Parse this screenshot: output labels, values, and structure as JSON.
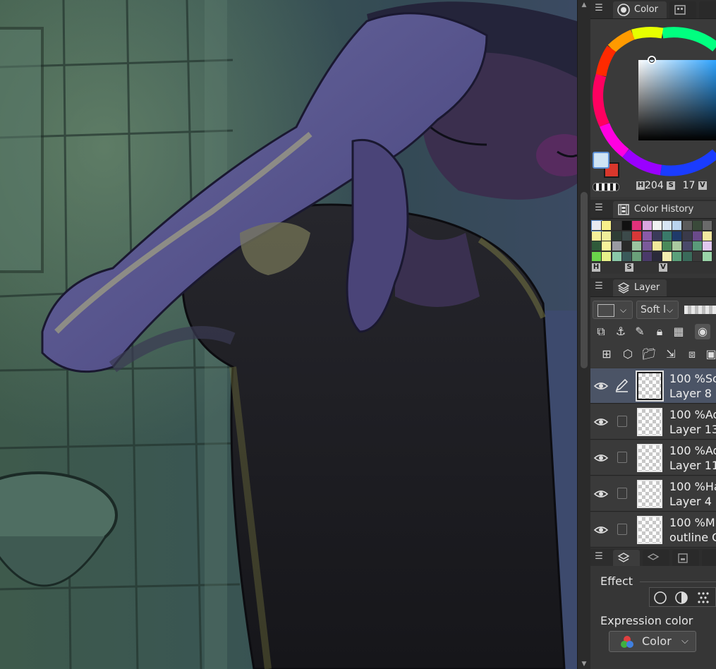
{
  "color_panel": {
    "tab_label": "Color",
    "h_label": "H",
    "h_value": "204",
    "s_label": "S",
    "s_value": "17",
    "v_label": "V",
    "hue_indicator_color": "#2fa4ff",
    "main_color": "#cfe4f5",
    "sub_color": "#d9372c"
  },
  "color_history": {
    "tab_label": "Color History",
    "h_label": "H",
    "s_label": "S",
    "v_label": "V",
    "swatches": [
      [
        "#e9e9f0",
        "#f7ef8a",
        "#3a3a3a",
        "#111111",
        "#e0317a",
        "#d9a6e0",
        "#f2f2f2",
        "#d8e6f5",
        "#b9d4ee",
        "#5b5b5b",
        "#3a4a3a",
        "#6a6a6a"
      ],
      [
        "#f4f09a",
        "#f0ee9a",
        "#2f3d36",
        "#3c4a4a",
        "#d83838",
        "#8a5aa8",
        "#3a3a5a",
        "#3a7a6a",
        "#1f3a6a",
        "#3a3a4a",
        "#6a4a8a",
        "#f4e8a0"
      ],
      [
        "#2f5a3a",
        "#f7f29a",
        "#9a9aa2",
        "#2a2a2a",
        "#9bc4a0",
        "#7a5a9a",
        "#f0e89a",
        "#4a8a5a",
        "#aacaa0",
        "#4a4a6a",
        "#5a9a7a",
        "#e0c8f0"
      ],
      [
        "#6ad44a",
        "#e8f08a",
        "#8ac8a8",
        "#3a5a5a",
        "#6aa07a",
        "#4a3a6a",
        "#2a2a3a",
        "#f2eeb0",
        "#5aa07a",
        "#3a6a5a",
        "#3a3a3a",
        "#9ad4a8"
      ]
    ]
  },
  "layer_panel": {
    "tab_label": "Layer",
    "blend_mode": "Soft l",
    "layers": [
      {
        "opacity": "100 %",
        "blend": "Sc",
        "name": "Layer 8",
        "selected": true
      },
      {
        "opacity": "100 %",
        "blend": "Ad",
        "name": "Layer 13",
        "selected": false
      },
      {
        "opacity": "100 %",
        "blend": "Ad",
        "name": "Layer 11",
        "selected": false
      },
      {
        "opacity": "100 %",
        "blend": "Ha",
        "name": "Layer 4",
        "selected": false
      },
      {
        "opacity": "100 %",
        "blend": "M",
        "name": "outline C",
        "selected": false
      }
    ]
  },
  "properties": {
    "effect_label": "Effect",
    "expression_color_label": "Expression color",
    "expression_color_value": "Color"
  }
}
